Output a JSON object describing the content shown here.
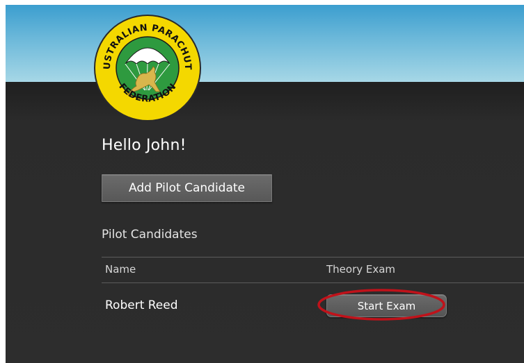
{
  "header": {
    "logo": {
      "name": "Australian Parachute Federation logo",
      "top_text": "AUSTRALIAN PARACHUTE",
      "bottom_text": "FEDERATION",
      "colors": {
        "ring": "#f4d800",
        "inner": "#2e9a3f",
        "canopy": "#ffffff",
        "kangaroo": "#d9b64c",
        "text": "#111111"
      }
    }
  },
  "main": {
    "greeting": "Hello John!",
    "add_button_label": "Add Pilot Candidate",
    "section_title": "Pilot Candidates",
    "table": {
      "columns": [
        "Name",
        "Theory Exam"
      ],
      "rows": [
        {
          "name": "Robert Reed",
          "action_label": "Start Exam"
        }
      ]
    }
  },
  "annotation": {
    "type": "ellipse-highlight",
    "color": "#c0121a",
    "target": "Start Exam"
  },
  "colors": {
    "header_top": "#3b9ecf",
    "header_bottom": "#a6d7e6",
    "background": "#2b2b2b",
    "button": "#5f5f5f",
    "text": "#ffffff"
  }
}
